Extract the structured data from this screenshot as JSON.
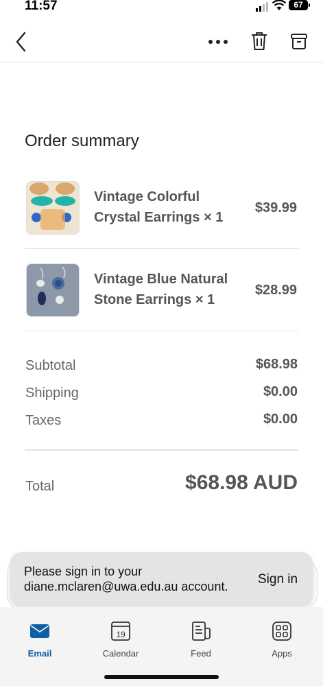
{
  "status": {
    "time": "11:57",
    "battery": "67"
  },
  "toolbar": {
    "back_icon": "chevron-left-icon",
    "more_icon": "more-horizontal-icon",
    "delete_icon": "trash-icon",
    "archive_icon": "archive-box-icon"
  },
  "order": {
    "title": "Order summary",
    "items": [
      {
        "name": "Vintage Colorful Crystal Earrings × 1",
        "price": "$39.99",
        "thumb_colors": [
          "#d8a86e",
          "#23b3a8",
          "#2f68c8"
        ]
      },
      {
        "name": "Vintage Blue Natural Stone Earrings × 1",
        "price": "$28.99",
        "thumb_colors": [
          "#6e7f95",
          "#2c4f86",
          "#e8ece6"
        ]
      }
    ],
    "summary": [
      {
        "label": "Subtotal",
        "value": "$68.98"
      },
      {
        "label": "Shipping",
        "value": "$0.00"
      },
      {
        "label": "Taxes",
        "value": "$0.00"
      }
    ],
    "total": {
      "label": "Total",
      "value": "$68.98 AUD"
    }
  },
  "toast": {
    "message": "Please sign in to your diane.mclaren@uwa.edu.au account.",
    "action": "Sign in"
  },
  "tabs": [
    {
      "label": "Email",
      "icon": "email-icon",
      "active": true
    },
    {
      "label": "Calendar",
      "icon": "calendar-icon",
      "icon_text": "19"
    },
    {
      "label": "Feed",
      "icon": "feed-icon"
    },
    {
      "label": "Apps",
      "icon": "apps-grid-icon"
    }
  ],
  "colors": {
    "accent": "#0f5ea8",
    "toast_bg": "#e4e4e4",
    "tab_bar_bg": "#f4f4f4"
  }
}
